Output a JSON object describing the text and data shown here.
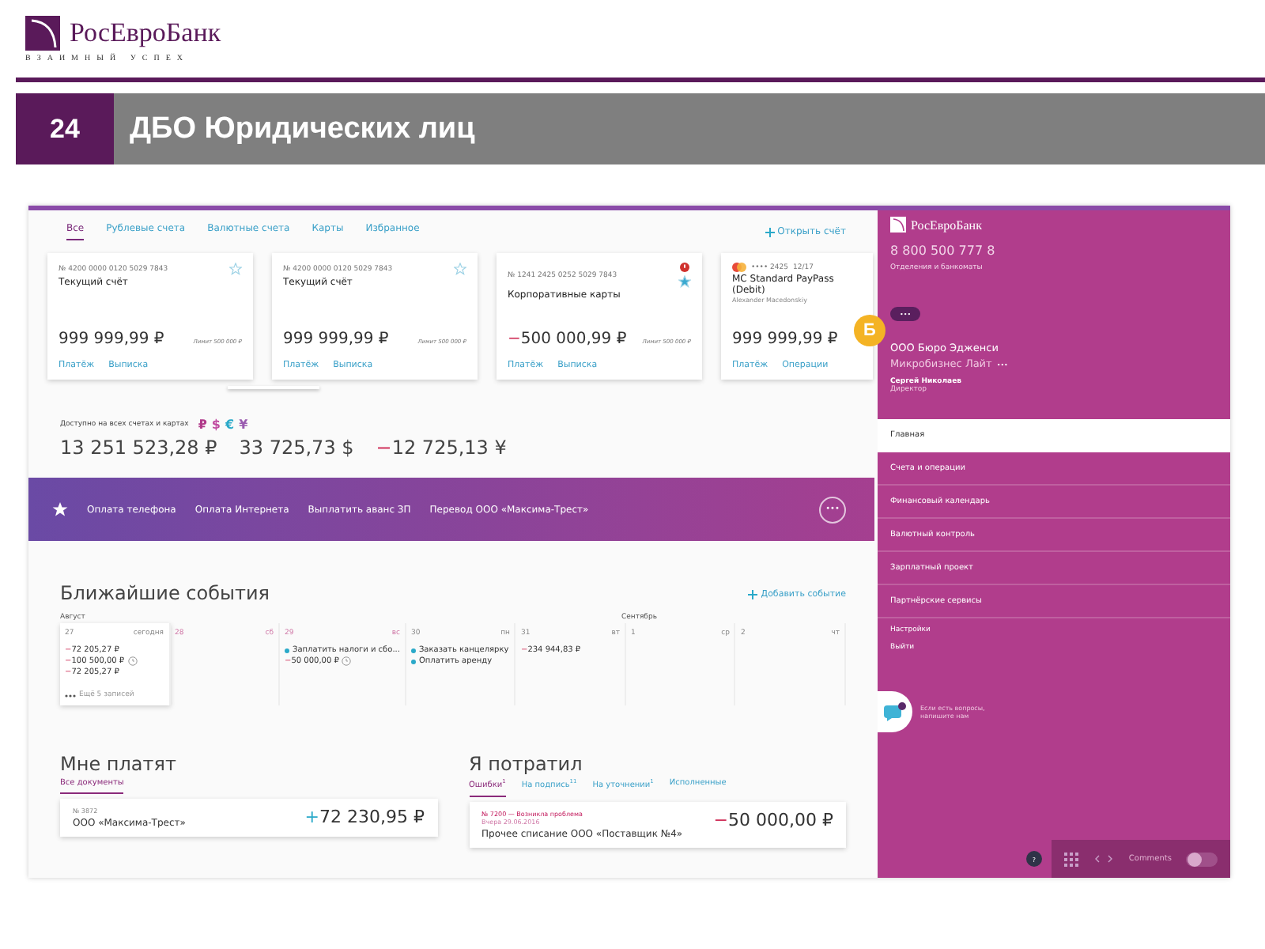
{
  "slide": {
    "logo": "РосЕвроБанк",
    "tagline": "ВЗАИМНЫЙ УСПЕХ",
    "number": "24",
    "title": "ДБО Юридических лиц"
  },
  "account_tabs": [
    {
      "label": "Все",
      "selected": true
    },
    {
      "label": "Рублевые счета",
      "selected": false
    },
    {
      "label": "Валютные счета",
      "selected": false
    },
    {
      "label": "Карты",
      "selected": false
    },
    {
      "label": "Избранное",
      "selected": false
    }
  ],
  "open_account": "Открыть счёт",
  "accounts": [
    {
      "kind": "account",
      "number": "№ 4200 0000 0120 5029 7843",
      "name": "Текущий счёт",
      "amount": "999 999,99 ₽",
      "limit": "Лимит 500 000 ₽",
      "starred": false,
      "alert": false,
      "actions": [
        "Платёж",
        "Выписка"
      ]
    },
    {
      "kind": "account",
      "number": "№ 4200 0000 0120 5029 7843",
      "name": "Текущий счёт",
      "amount": "999 999,99 ₽",
      "limit": "Лимит 500 000 ₽",
      "starred": false,
      "alert": false,
      "actions": [
        "Платёж",
        "Выписка"
      ]
    },
    {
      "kind": "account",
      "number": "№ 1241 2425 0252 5029 7843",
      "name": "Корпоративные карты",
      "sign": "−",
      "amount": "500 000,99 ₽",
      "limit": "Лимит 500 000 ₽",
      "starred": true,
      "alert": true,
      "actions": [
        "Платёж",
        "Выписка"
      ]
    },
    {
      "kind": "card",
      "number": "•••• 2425",
      "expiry": "12/17",
      "name": "MC Standard PayPass (Debit)",
      "holder": "Alexander Macedonskiy",
      "amount": "999 999,99 ₽",
      "actions": [
        "Платёж",
        "Операции"
      ]
    }
  ],
  "balance": {
    "label": "Доступно на всех счетах и картах",
    "currencies": [
      {
        "symbol": "₽",
        "color": "#b03a8a"
      },
      {
        "symbol": "$",
        "color": "#c04aa0"
      },
      {
        "symbol": "€",
        "color": "#2aa9c9"
      },
      {
        "symbol": "¥",
        "color": "#9a5bb0"
      }
    ],
    "totals": [
      {
        "amount": "13 251 523,28 ₽"
      },
      {
        "amount": "33 725,73 $"
      },
      {
        "sign": "−",
        "amount": "12 725,13 ¥"
      }
    ]
  },
  "quick_payments": {
    "items": [
      "Оплата телефона",
      "Оплата Интернета",
      "Выплатить аванс ЗП",
      "Перевод ООО «Максима-Трест»"
    ],
    "more": "•••"
  },
  "events": {
    "title": "Ближайшие события",
    "add": "Добавить событие",
    "days": [
      {
        "month": "Август",
        "date": "27",
        "weekday": "сегодня",
        "today": true,
        "weekend": false,
        "entries": [
          {
            "kind": "amount",
            "sign": "−",
            "text": "72 205,27 ₽",
            "clock": false
          },
          {
            "kind": "amount",
            "sign": "−",
            "text": "100 500,00 ₽",
            "clock": true
          },
          {
            "kind": "amount",
            "sign": "−",
            "text": "72 205,27 ₽",
            "clock": false
          }
        ],
        "more": "Ещё 5 записей"
      },
      {
        "date": "28",
        "weekday": "сб",
        "today": false,
        "weekend": true
      },
      {
        "date": "29",
        "weekday": "вс",
        "today": false,
        "weekend": true,
        "entries": [
          {
            "kind": "task",
            "text": "Заплатить налоги и сбо...",
            "clock": false
          },
          {
            "kind": "amount",
            "sign": "−",
            "text": "50 000,00 ₽",
            "clock": true
          }
        ]
      },
      {
        "date": "30",
        "weekday": "пн",
        "today": false,
        "weekend": false,
        "entries": [
          {
            "kind": "task",
            "text": "Заказать канцелярку",
            "clock": false
          },
          {
            "kind": "task",
            "text": "Оплатить аренду",
            "clock": false
          }
        ]
      },
      {
        "date": "31",
        "weekday": "вт",
        "today": false,
        "weekend": false,
        "entries": [
          {
            "kind": "amount",
            "sign": "−",
            "text": "234 944,83 ₽",
            "clock": false
          }
        ]
      },
      {
        "month": "Сентябрь",
        "date": "1",
        "weekday": "ср",
        "today": false,
        "weekend": false
      },
      {
        "date": "2",
        "weekday": "чт",
        "today": false,
        "weekend": false
      }
    ]
  },
  "incoming": {
    "title": "Мне платят",
    "tabs": [
      {
        "label": "Все документы",
        "selected": true
      }
    ],
    "doc": {
      "number": "№ 3872",
      "name": "ООО «Максима-Трест»",
      "sign": "+",
      "amount": "72 230,95 ₽"
    }
  },
  "spent": {
    "title": "Я потратил",
    "tabs": [
      {
        "label": "Ошибки",
        "count": "1",
        "selected": true
      },
      {
        "label": "На подпись",
        "count": "11",
        "selected": false
      },
      {
        "label": "На уточнении",
        "count": "1",
        "selected": false
      },
      {
        "label": "Исполненные",
        "selected": false
      }
    ],
    "doc": {
      "number": "№ 7200 — Возникла проблема",
      "date": "Вчера 29.06.2016",
      "name": "Прочее списание ООО «Поставщик №4»",
      "sign": "−",
      "amount": "50 000,00 ₽"
    }
  },
  "sidebar": {
    "logo": "РосЕвроБанк",
    "phone": "8 800 500 777 8",
    "offices": "Отделения и банкоматы",
    "more": "•••",
    "company": "ООО Бюро Эдженси",
    "tariff": "Микробизнес Лайт",
    "tariff_more": "•••",
    "user": "Сергей Николаев",
    "role": "Директор",
    "nav": [
      {
        "label": "Главная",
        "selected": true
      },
      {
        "label": "Счета и операции",
        "selected": false
      },
      {
        "label": "Финансовый календарь",
        "selected": false
      },
      {
        "label": "Валютный контроль",
        "selected": false
      },
      {
        "label": "Зарплатный проект",
        "selected": false
      },
      {
        "label": "Партнёрские сервисы",
        "selected": false
      }
    ],
    "links": [
      "Настройки",
      "Выйти"
    ],
    "chat": "Если есть вопросы, напишите нам"
  },
  "callout": "Б",
  "toolbar": {
    "help": "?",
    "comments": "Comments",
    "comments_on": false
  }
}
